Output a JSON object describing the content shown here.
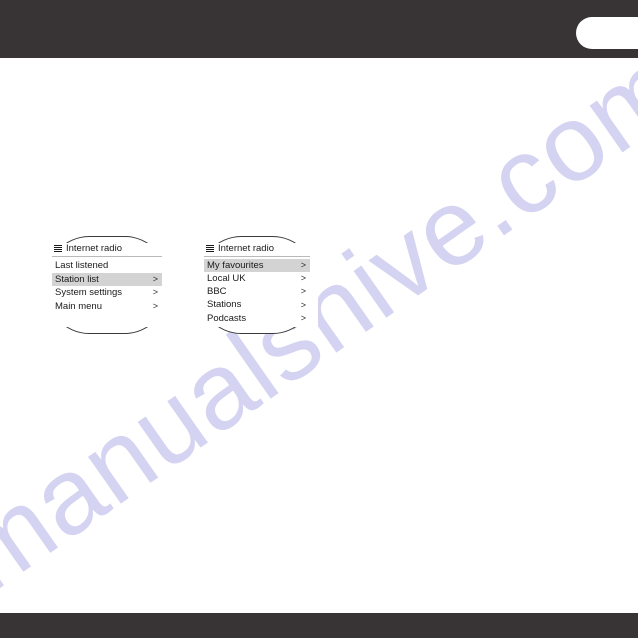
{
  "page": {
    "background_color": "#ffffff",
    "band_color": "#383436",
    "watermark": "manualshive.com",
    "watermark_color": "#c9c7ee"
  },
  "top_bar": {
    "page_tab_label": ""
  },
  "bottom_bar": {
    "label": ""
  },
  "displays": [
    {
      "id": "internet-radio-menu",
      "header": {
        "icon": "hamburger-menu-icon",
        "title": "Internet radio"
      },
      "items": [
        {
          "label": "Last listened",
          "chevron": ">",
          "has_chevron": false,
          "selected": false
        },
        {
          "label": "Station list",
          "chevron": ">",
          "has_chevron": true,
          "selected": true
        },
        {
          "label": "System settings",
          "chevron": ">",
          "has_chevron": true,
          "selected": false
        },
        {
          "label": "Main menu",
          "chevron": ">",
          "has_chevron": true,
          "selected": false
        }
      ]
    },
    {
      "id": "internet-radio-station-list",
      "header": {
        "icon": "hamburger-menu-icon",
        "title": "Internet radio"
      },
      "items": [
        {
          "label": "My favourites",
          "chevron": ">",
          "has_chevron": true,
          "selected": true
        },
        {
          "label": "Local UK",
          "chevron": ">",
          "has_chevron": true,
          "selected": false
        },
        {
          "label": "BBC",
          "chevron": ">",
          "has_chevron": true,
          "selected": false
        },
        {
          "label": "Stations",
          "chevron": ">",
          "has_chevron": true,
          "selected": false
        },
        {
          "label": "Podcasts",
          "chevron": ">",
          "has_chevron": true,
          "selected": false
        }
      ]
    }
  ]
}
